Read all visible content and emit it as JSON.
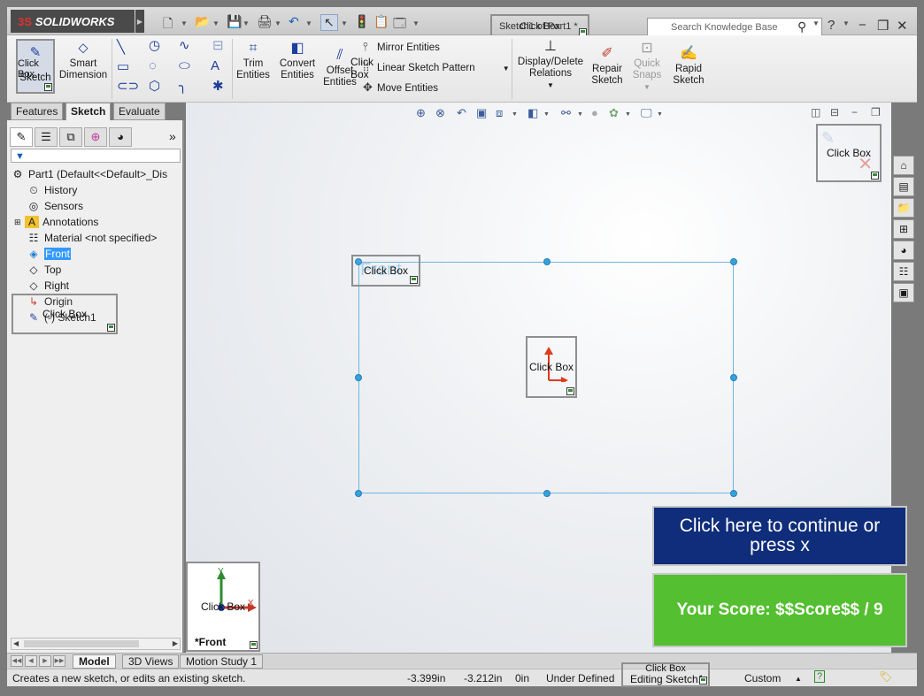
{
  "app": {
    "brand_prefix": "3S",
    "brand_name": "SOLIDWORKS",
    "window_title": "Sketch1 of Part1 *",
    "search_placeholder": "Search Knowledge Base"
  },
  "ribbon": {
    "sketch_label": "Sketch",
    "smart_dimension_line1": "Smart",
    "smart_dimension_line2": "Dimension",
    "trim_line1": "Trim",
    "trim_line2": "Entities",
    "convert_line1": "Convert",
    "convert_line2": "Entities",
    "offset_line1": "Offset",
    "offset_line2": "Entities",
    "mirror": "Mirror Entities",
    "linear_pattern": "Linear Sketch Pattern",
    "move": "Move Entities",
    "display_delete_line1": "Display/Delete",
    "display_delete_line2": "Relations",
    "repair_line1": "Repair",
    "repair_line2": "Sketch",
    "quick_snaps_line1": "Quick",
    "quick_snaps_line2": "Snaps",
    "rapid_line1": "Rapid",
    "rapid_line2": "Sketch"
  },
  "command_tabs": [
    "Features",
    "Sketch",
    "Evaluate"
  ],
  "feature_tree": [
    {
      "label": "Part1  (Default<<Default>_Dis",
      "icon": "part-icon"
    },
    {
      "label": "History",
      "icon": "history-icon"
    },
    {
      "label": "Sensors",
      "icon": "sensors-icon"
    },
    {
      "label": "Annotations",
      "icon": "annotations-icon"
    },
    {
      "label": "Material <not specified>",
      "icon": "material-icon"
    },
    {
      "label": "Front",
      "icon": "plane-icon"
    },
    {
      "label": "Top",
      "icon": "plane-icon"
    },
    {
      "label": "Right",
      "icon": "plane-icon"
    },
    {
      "label": "Origin",
      "icon": "origin-icon"
    },
    {
      "label": "(-) Sketch1",
      "icon": "sketch-icon"
    }
  ],
  "canvas": {
    "front_label": "Front",
    "orientation_label": "*Front",
    "triad_y": "Y",
    "triad_x": "X"
  },
  "click_box_label": "Click Box",
  "continue_button": "Click here to continue or press x",
  "score_text": "Your Score: $$Score$$ / 9",
  "bottom_tabs": [
    "Model",
    "3D Views",
    "Motion Study 1"
  ],
  "status": {
    "message": "Creates a new sketch, or edits an existing sketch.",
    "x": "-3.399in",
    "y": "-3.212in",
    "z": "0in",
    "state": "Under Defined",
    "editing": "Editing Sketch1",
    "units": "Custom"
  },
  "colors": {
    "continue_bg": "#0f2d7a",
    "score_bg": "#54bf30",
    "selection": "#3399ff",
    "sketch_line": "#6fb6e0"
  }
}
